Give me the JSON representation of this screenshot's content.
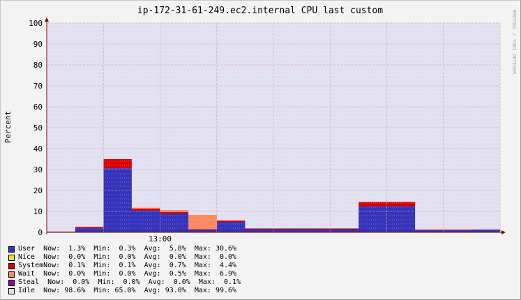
{
  "chart_data": {
    "type": "area",
    "stacked": true,
    "title": "ip-172-31-61-249.ec2.internal CPU last custom",
    "ylabel": "Percent",
    "xlabel": "",
    "ylim": [
      0,
      100
    ],
    "yticks": [
      "0",
      "10",
      "20",
      "30",
      "40",
      "50",
      "60",
      "70",
      "80",
      "90",
      "100"
    ],
    "xticks": [
      {
        "label": "13:00",
        "index": 4
      }
    ],
    "grid": true,
    "side_label": "RRDTOOL / TOBI OETIKER",
    "segments": 16,
    "series": [
      {
        "name": "User",
        "color": "#3333bb",
        "values": [
          0.3,
          2.0,
          30.6,
          10.5,
          9.0,
          1.3,
          5.0,
          1.5,
          1.5,
          1.5,
          1.5,
          12.5,
          12.5,
          1.0,
          1.0,
          1.3
        ]
      },
      {
        "name": "Nice",
        "color": "#ffea00",
        "values": [
          0,
          0,
          0,
          0,
          0,
          0,
          0,
          0,
          0,
          0,
          0,
          0,
          0,
          0,
          0,
          0
        ]
      },
      {
        "name": "System",
        "color": "#dd0000",
        "values": [
          0.1,
          0.7,
          4.4,
          0.8,
          0.7,
          0.2,
          0.6,
          0.4,
          0.4,
          0.4,
          0.4,
          2.0,
          2.0,
          0.3,
          0.3,
          0.1
        ]
      },
      {
        "name": "Wait",
        "color": "#ff8a60",
        "values": [
          0,
          0,
          0,
          0.5,
          1.0,
          6.9,
          0.2,
          0,
          0,
          0,
          0,
          0,
          0,
          0,
          0,
          0
        ]
      },
      {
        "name": "Steal",
        "color": "#9900aa",
        "values": [
          0,
          0,
          0,
          0,
          0,
          0,
          0,
          0,
          0,
          0,
          0,
          0,
          0,
          0,
          0,
          0
        ]
      },
      {
        "name": "Idle",
        "color": "#e2e2f2",
        "values": [
          99.6,
          97.3,
          65.0,
          88.2,
          89.3,
          91.6,
          94.2,
          98.1,
          98.1,
          98.1,
          98.1,
          85.5,
          85.5,
          98.7,
          98.7,
          98.6
        ]
      }
    ]
  },
  "legend": [
    {
      "color": "#3333bb",
      "text": "User  Now:  1.3%  Min:  0.3%  Avg:  5.8%  Max: 30.6%"
    },
    {
      "color": "#ffea00",
      "text": "Nice  Now:  0.0%  Min:  0.0%  Avg:  0.0%  Max:  0.0%"
    },
    {
      "color": "#dd0000",
      "text": "SystemNow:  0.1%  Min:  0.1%  Avg:  0.7%  Max:  4.4%"
    },
    {
      "color": "#ff8a60",
      "text": "Wait  Now:  0.0%  Min:  0.0%  Avg:  0.5%  Max:  6.9%"
    },
    {
      "color": "#9900aa",
      "text": "Steal  Now:  0.0%  Min:  0.0%  Avg:  0.0%  Max:  0.1%"
    },
    {
      "color": "#e2e2f2",
      "text": "Idle  Now: 98.6%  Min: 65.0%  Avg: 93.0%  Max: 99.6%"
    }
  ]
}
